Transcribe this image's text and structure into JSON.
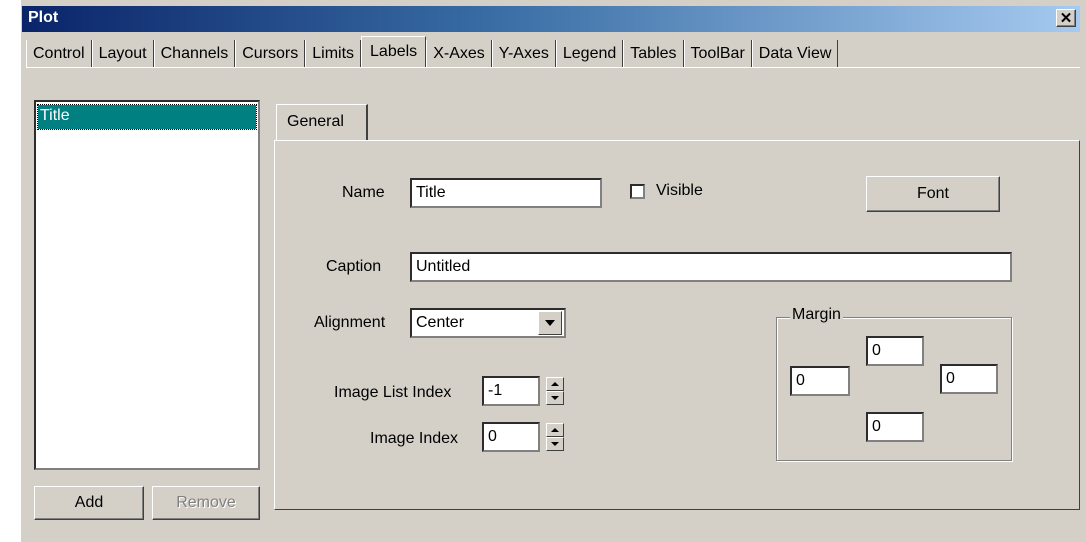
{
  "window": {
    "title": "Plot",
    "close_glyph": "✕"
  },
  "tabs": [
    {
      "label": "Control"
    },
    {
      "label": "Layout"
    },
    {
      "label": "Channels"
    },
    {
      "label": "Cursors"
    },
    {
      "label": "Limits"
    },
    {
      "label": "Labels"
    },
    {
      "label": "X-Axes"
    },
    {
      "label": "Y-Axes"
    },
    {
      "label": "Legend"
    },
    {
      "label": "Tables"
    },
    {
      "label": "ToolBar"
    },
    {
      "label": "Data View"
    }
  ],
  "active_tab": "Labels",
  "list": {
    "items": [
      "Title"
    ],
    "selected": "Title"
  },
  "buttons": {
    "add": "Add",
    "remove": "Remove",
    "font": "Font"
  },
  "subtab": {
    "label": "General"
  },
  "form": {
    "name_label": "Name",
    "name_value": "Title",
    "visible_label": "Visible",
    "visible_checked": false,
    "caption_label": "Caption",
    "caption_value": "Untitled",
    "alignment_label": "Alignment",
    "alignment_value": "Center",
    "image_list_index_label": "Image List Index",
    "image_list_index_value": "-1",
    "image_index_label": "Image Index",
    "image_index_value": "0"
  },
  "margin": {
    "title": "Margin",
    "top": "0",
    "left": "0",
    "right": "0",
    "bottom": "0"
  },
  "colors": {
    "selection": "#008080",
    "face": "#d4d0c8",
    "title_start": "#0a246a"
  }
}
